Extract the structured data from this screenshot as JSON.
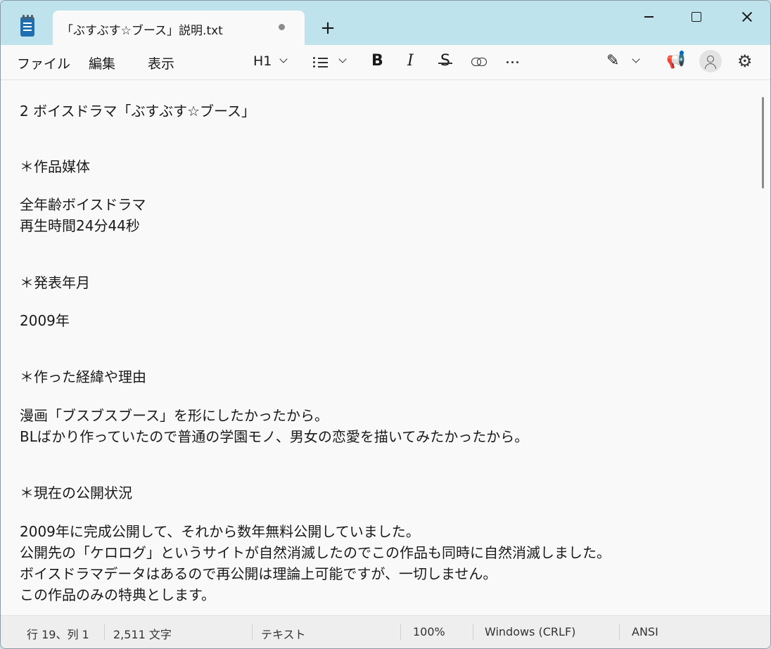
{
  "titlebar": {
    "tab_title": "「ぶすぶす☆ブース」説明.txt",
    "new_tab_label": "+"
  },
  "menu": {
    "items": [
      "ファイル",
      "編集",
      "表示"
    ]
  },
  "toolbar": {
    "heading_label": "H1",
    "bold_label": "B",
    "italic_label": "I",
    "strike_label": "S"
  },
  "editor": {
    "lines": [
      "2 ボイスドラマ「ぶすぶす☆ブース」",
      "＊作品媒体",
      "全年齢ボイスドラマ",
      "再生時間24分44秒",
      "＊発表年月",
      "2009年",
      "＊作った経緯や理由",
      "漫画「ブスブスブース」を形にしたかったから。",
      "BLばかり作っていたので普通の学園モノ、男女の恋愛を描いてみたかったから。",
      "＊現在の公開状況",
      "2009年に完成公開して、それから数年無料公開していました。",
      "公開先の「ケロログ」というサイトが自然消滅したのでこの作品も同時に自然消滅しました。",
      "ボイスドラマデータはあるので再公開は理論上可能ですが、一切しません。",
      "この作品のみの特典とします。"
    ]
  },
  "status": {
    "position": "行 19、列 1",
    "chars": "2,511 文字",
    "format": "テキスト",
    "zoom": "100%",
    "line_ending": "Windows (CRLF)",
    "encoding": "ANSI"
  },
  "colors": {
    "titlebar_bg": "#bfe3ec",
    "editor_bg": "#f9f9f9",
    "accent": "#0067c0"
  }
}
